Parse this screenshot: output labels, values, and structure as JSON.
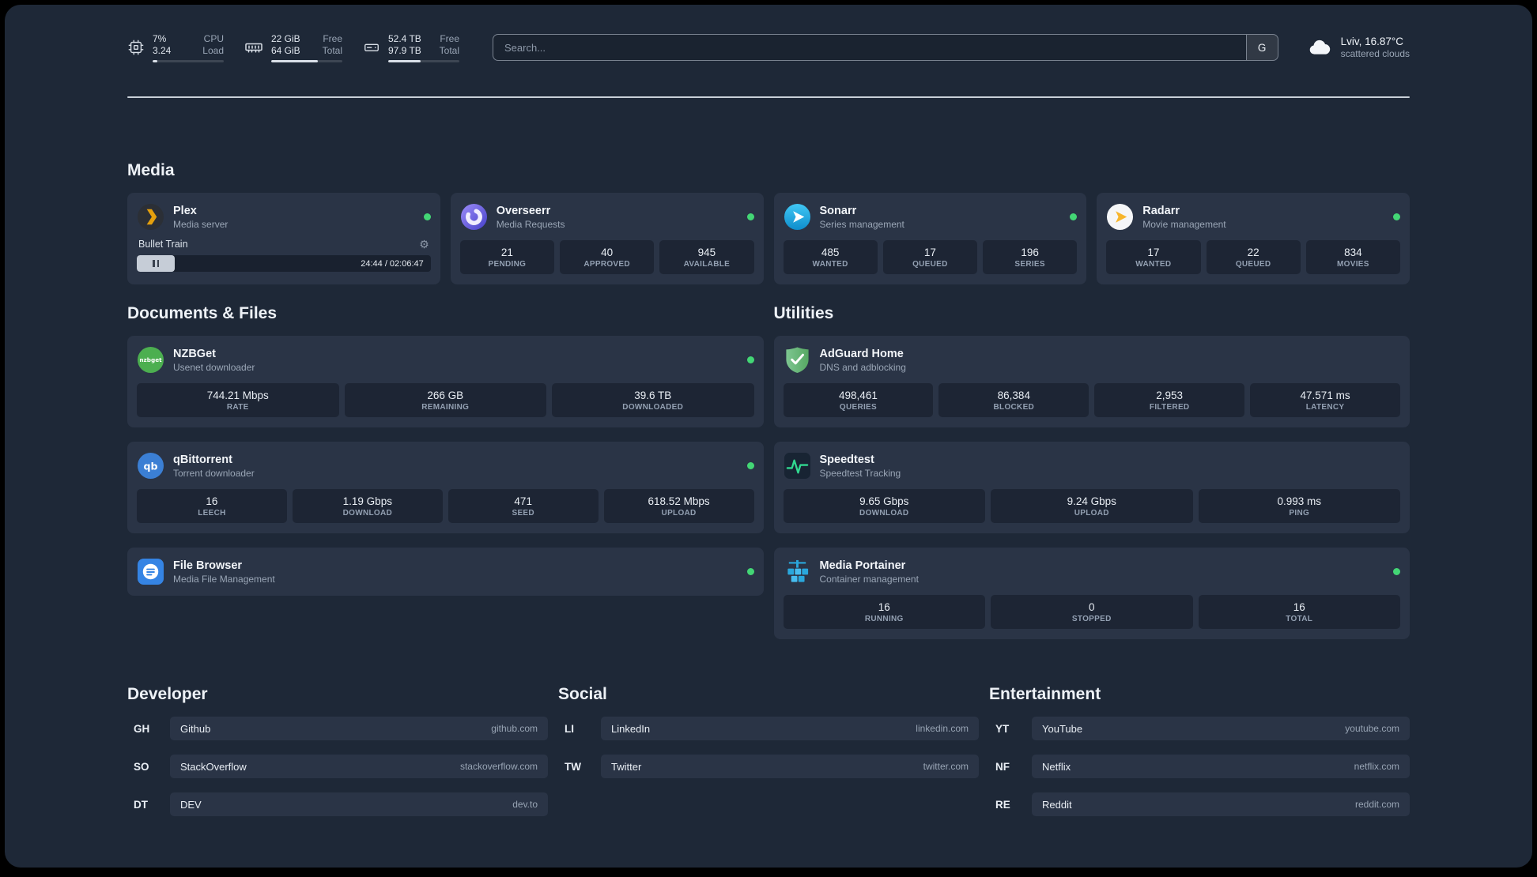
{
  "topbar": {
    "cpu": {
      "value": "7%",
      "sub": "3.24",
      "label_top": "CPU",
      "label_bottom": "Load",
      "percent": 7
    },
    "memory": {
      "value": "22 GiB",
      "sub": "64 GiB",
      "label_top": "Free",
      "label_bottom": "Total",
      "percent": 66
    },
    "disk": {
      "value": "52.4 TB",
      "sub": "97.9 TB",
      "label_top": "Free",
      "label_bottom": "Total",
      "percent": 46
    },
    "search": {
      "placeholder": "Search...",
      "provider_button": "G"
    },
    "weather": {
      "location": "Lviv, 16.87°C",
      "condition": "scattered clouds"
    }
  },
  "sections": {
    "media": {
      "title": "Media",
      "plex": {
        "name": "Plex",
        "desc": "Media server",
        "now_playing": "Bullet Train",
        "time": "24:44 / 02:06:47",
        "progress_percent": 13
      },
      "overseerr": {
        "name": "Overseerr",
        "desc": "Media Requests",
        "stats": [
          {
            "value": "21",
            "label": "PENDING"
          },
          {
            "value": "40",
            "label": "APPROVED"
          },
          {
            "value": "945",
            "label": "AVAILABLE"
          }
        ]
      },
      "sonarr": {
        "name": "Sonarr",
        "desc": "Series management",
        "stats": [
          {
            "value": "485",
            "label": "WANTED"
          },
          {
            "value": "17",
            "label": "QUEUED"
          },
          {
            "value": "196",
            "label": "SERIES"
          }
        ]
      },
      "radarr": {
        "name": "Radarr",
        "desc": "Movie management",
        "stats": [
          {
            "value": "17",
            "label": "WANTED"
          },
          {
            "value": "22",
            "label": "QUEUED"
          },
          {
            "value": "834",
            "label": "MOVIES"
          }
        ]
      }
    },
    "documents": {
      "title": "Documents & Files",
      "nzbget": {
        "name": "NZBGet",
        "desc": "Usenet downloader",
        "stats": [
          {
            "value": "744.21 Mbps",
            "label": "RATE"
          },
          {
            "value": "266 GB",
            "label": "REMAINING"
          },
          {
            "value": "39.6 TB",
            "label": "DOWNLOADED"
          }
        ]
      },
      "qbittorrent": {
        "name": "qBittorrent",
        "desc": "Torrent downloader",
        "stats": [
          {
            "value": "16",
            "label": "LEECH"
          },
          {
            "value": "1.19 Gbps",
            "label": "DOWNLOAD"
          },
          {
            "value": "471",
            "label": "SEED"
          },
          {
            "value": "618.52 Mbps",
            "label": "UPLOAD"
          }
        ]
      },
      "filebrowser": {
        "name": "File Browser",
        "desc": "Media File Management"
      }
    },
    "utilities": {
      "title": "Utilities",
      "adguard": {
        "name": "AdGuard Home",
        "desc": "DNS and adblocking",
        "stats": [
          {
            "value": "498,461",
            "label": "QUERIES"
          },
          {
            "value": "86,384",
            "label": "BLOCKED"
          },
          {
            "value": "2,953",
            "label": "FILTERED"
          },
          {
            "value": "47.571 ms",
            "label": "LATENCY"
          }
        ]
      },
      "speedtest": {
        "name": "Speedtest",
        "desc": "Speedtest Tracking",
        "stats": [
          {
            "value": "9.65 Gbps",
            "label": "DOWNLOAD"
          },
          {
            "value": "9.24 Gbps",
            "label": "UPLOAD"
          },
          {
            "value": "0.993 ms",
            "label": "PING"
          }
        ]
      },
      "portainer": {
        "name": "Media Portainer",
        "desc": "Container management",
        "stats": [
          {
            "value": "16",
            "label": "RUNNING"
          },
          {
            "value": "0",
            "label": "STOPPED"
          },
          {
            "value": "16",
            "label": "TOTAL"
          }
        ]
      }
    }
  },
  "bookmarks": {
    "developer": {
      "title": "Developer",
      "items": [
        {
          "abbr": "GH",
          "name": "Github",
          "domain": "github.com"
        },
        {
          "abbr": "SO",
          "name": "StackOverflow",
          "domain": "stackoverflow.com"
        },
        {
          "abbr": "DT",
          "name": "DEV",
          "domain": "dev.to"
        }
      ]
    },
    "social": {
      "title": "Social",
      "items": [
        {
          "abbr": "LI",
          "name": "LinkedIn",
          "domain": "linkedin.com"
        },
        {
          "abbr": "TW",
          "name": "Twitter",
          "domain": "twitter.com"
        }
      ]
    },
    "entertainment": {
      "title": "Entertainment",
      "items": [
        {
          "abbr": "YT",
          "name": "YouTube",
          "domain": "youtube.com"
        },
        {
          "abbr": "NF",
          "name": "Netflix",
          "domain": "netflix.com"
        },
        {
          "abbr": "RE",
          "name": "Reddit",
          "domain": "reddit.com"
        }
      ]
    }
  },
  "colors": {
    "status_online": "#43d675"
  }
}
